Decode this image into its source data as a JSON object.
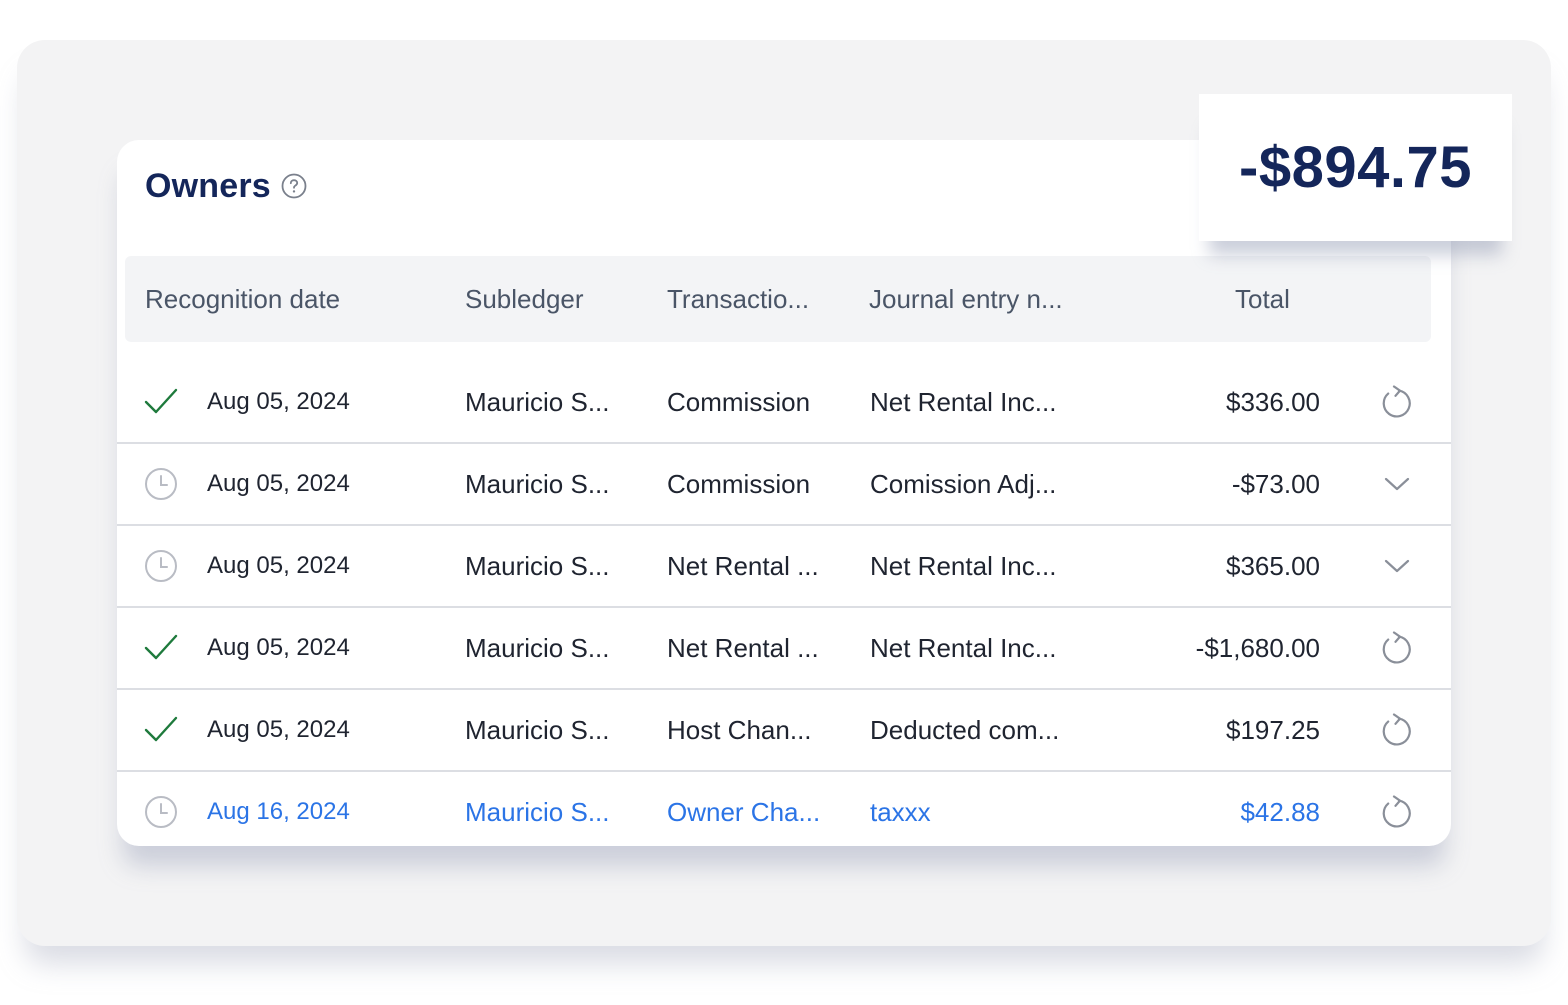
{
  "card": {
    "title": "Owners"
  },
  "summary": {
    "total": "-$894.75"
  },
  "table": {
    "columns": [
      "Recognition date",
      "Subledger",
      "Transactio...",
      "Journal entry n...",
      "Total"
    ],
    "rows": [
      {
        "status": "check",
        "date": "Aug 05, 2024",
        "subledger": "Mauricio S...",
        "transaction": "Commission",
        "journal": "Net Rental Inc...",
        "total": "$336.00",
        "action": "refresh"
      },
      {
        "status": "clock",
        "date": "Aug 05, 2024",
        "subledger": "Mauricio S...",
        "transaction": "Commission",
        "journal": "Comission Adj...",
        "total": "-$73.00",
        "action": "chevron-down"
      },
      {
        "status": "clock",
        "date": "Aug 05, 2024",
        "subledger": "Mauricio S...",
        "transaction": "Net Rental ...",
        "journal": "Net Rental Inc...",
        "total": "$365.00",
        "action": "chevron-down"
      },
      {
        "status": "check",
        "date": "Aug 05, 2024",
        "subledger": "Mauricio S...",
        "transaction": "Net Rental ...",
        "journal": "Net Rental Inc...",
        "total": "-$1,680.00",
        "action": "refresh"
      },
      {
        "status": "check",
        "date": "Aug 05, 2024",
        "subledger": "Mauricio S...",
        "transaction": "Host Chan...",
        "journal": "Deducted com...",
        "total": "$197.25",
        "action": "refresh"
      },
      {
        "status": "clock",
        "date": "Aug 16, 2024",
        "subledger": "Mauricio S...",
        "transaction": "Owner Cha...",
        "journal": "taxxx",
        "total": "$42.88",
        "action": "refresh"
      }
    ]
  },
  "colors": {
    "title": "#14265a",
    "check": "#1e7a3c",
    "highlight": "#2b74e6",
    "icon_gray": "#b9bcc4"
  }
}
